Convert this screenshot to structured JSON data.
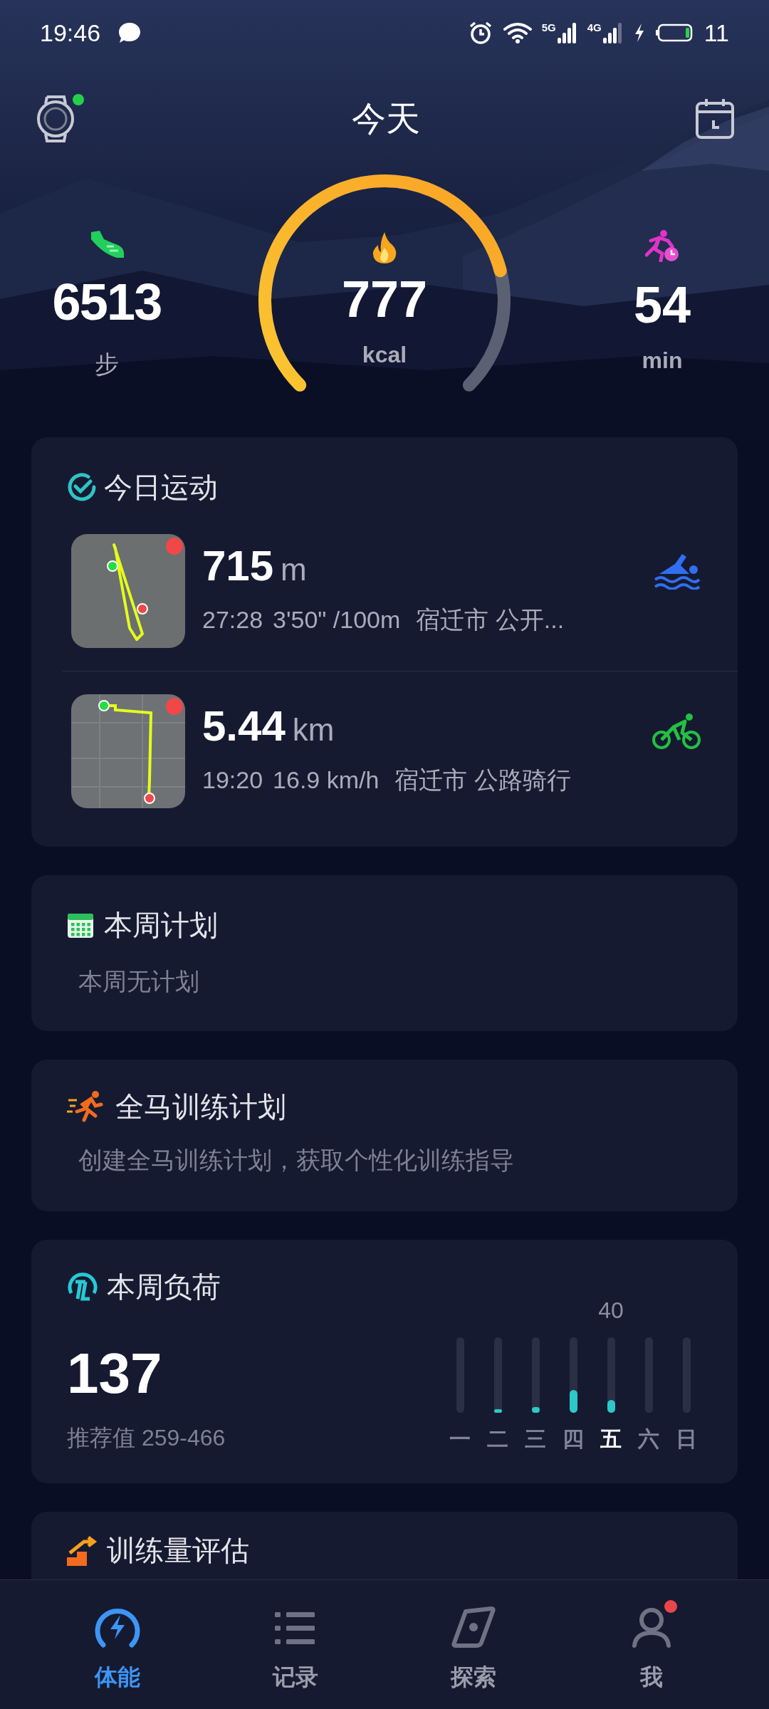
{
  "status_bar": {
    "time": "19:46",
    "network": [
      "5G",
      "4G"
    ],
    "battery": "11"
  },
  "header": {
    "title": "今天",
    "device_connected": true
  },
  "summary": {
    "steps": {
      "value": "6513",
      "unit": "步"
    },
    "calories": {
      "value": "777",
      "unit": "kcal"
    },
    "active": {
      "value": "54",
      "unit": "min"
    }
  },
  "today_activity": {
    "title": "今日运动",
    "items": [
      {
        "kind": "swim",
        "value": "715",
        "unit": "m",
        "metrics": [
          "27:28",
          "3'50\" /100m"
        ],
        "location": "宿迁市 公开..."
      },
      {
        "kind": "cycle",
        "value": "5.44",
        "unit": "km",
        "metrics": [
          "19:20",
          "16.9 km/h"
        ],
        "location": "宿迁市 公路骑行"
      }
    ]
  },
  "week_plan": {
    "title": "本周计划",
    "text": "本周无计划"
  },
  "marathon_plan": {
    "title": "全马训练计划",
    "text": "创建全马训练计划，获取个性化训练指导"
  },
  "weekly_load": {
    "title": "本周负荷",
    "value": "137",
    "recommended": "推荐值 259-466",
    "days": [
      {
        "label": "一",
        "selected": false
      },
      {
        "label": "二",
        "level": 0.05,
        "selected": false
      },
      {
        "label": "三",
        "level": 0.08,
        "selected": false
      },
      {
        "label": "四",
        "level": 0.3,
        "selected": false
      },
      {
        "label": "五",
        "level": 0.17,
        "selected": true,
        "value_label": "40"
      },
      {
        "label": "六",
        "selected": false
      },
      {
        "label": "日",
        "selected": false
      }
    ]
  },
  "training_assessment": {
    "title": "训练量评估"
  },
  "bottom_nav": [
    {
      "label": "体能",
      "selected": true
    },
    {
      "label": "记录",
      "selected": false
    },
    {
      "label": "探索",
      "selected": false
    },
    {
      "label": "我",
      "selected": false,
      "badge": true
    }
  ]
}
